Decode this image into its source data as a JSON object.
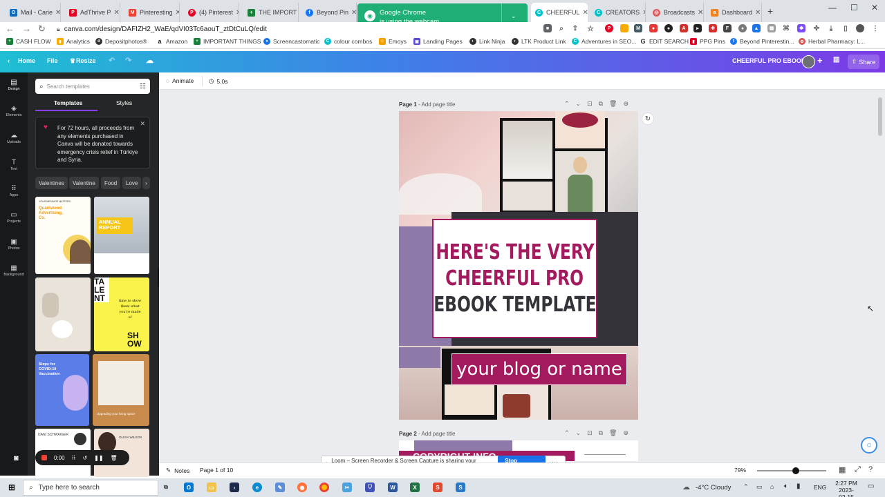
{
  "browser": {
    "tabs": [
      {
        "title": "Mail - Carie",
        "icon": "outlook-icon",
        "color": "#0f6cbd"
      },
      {
        "title": "AdThrive P",
        "icon": "pinterest-p-icon",
        "color": "#e60023"
      },
      {
        "title": "Pinteresting",
        "icon": "gmail-icon",
        "color": "#ea4335"
      },
      {
        "title": "(4) Pinterest",
        "icon": "pinterest-icon",
        "color": "#e60023"
      },
      {
        "title": "THE IMPORT",
        "icon": "sheets-icon",
        "color": "#188038"
      },
      {
        "title": "Beyond Pin",
        "icon": "facebook-icon",
        "color": "#1877f2"
      },
      {
        "title": "CHEERFUL",
        "icon": "canva-icon",
        "color": "#00c4cc"
      },
      {
        "title": "CREATORS",
        "icon": "canva-icon",
        "color": "#00c4cc"
      },
      {
        "title": "Broadcasts",
        "icon": "broadcast-icon",
        "color": "#e35b5b"
      },
      {
        "title": "Dashboard",
        "icon": "dashboard-icon",
        "color": "#f48120"
      }
    ],
    "url": "canva.com/design/DAFIZH2_WaE/qdVI03Tc6aouT_ztDtCuLQ/edit",
    "webcam_notice": {
      "line1": "Google Chrome",
      "line2": "is using the webcam"
    }
  },
  "bookmarks": [
    {
      "label": "CASH FLOW",
      "color": "#188038"
    },
    {
      "label": "Analytics",
      "color": "#f9ab00"
    },
    {
      "label": "Depositphotos®",
      "color": "#333333"
    },
    {
      "label": "Amazon",
      "color": "#222222"
    },
    {
      "label": "IMPORTANT THINGS",
      "color": "#188038"
    },
    {
      "label": "Screencastomatic",
      "color": "#1a73e8"
    },
    {
      "label": "colour combos",
      "color": "#00c4cc"
    },
    {
      "label": "Emoys",
      "color": "#f4a100"
    },
    {
      "label": "Landing Pages",
      "color": "#5b4bd6"
    },
    {
      "label": "Link Ninja",
      "color": "#333333"
    },
    {
      "label": "LTK Product Link",
      "color": "#333333"
    },
    {
      "label": "Adventures in SEO...",
      "color": "#00c4cc"
    },
    {
      "label": "EDIT SEARCH",
      "color": "#222222"
    },
    {
      "label": "PPG Pins",
      "color": "#e60023"
    },
    {
      "label": "Beyond Pinterestin...",
      "color": "#1877f2"
    },
    {
      "label": "Herbal Pharmacy: L...",
      "color": "#d9534f"
    }
  ],
  "canva_header": {
    "home": "Home",
    "file": "File",
    "resize": "Resize",
    "doc_title": "CHEERFUL PRO EBOOK",
    "share": "Share"
  },
  "rail": [
    {
      "label": "Design",
      "icon": "layout-icon"
    },
    {
      "label": "Elements",
      "icon": "shapes-icon"
    },
    {
      "label": "Uploads",
      "icon": "cloud-upload-icon"
    },
    {
      "label": "Text",
      "icon": "text-icon"
    },
    {
      "label": "Apps",
      "icon": "apps-grid-icon"
    },
    {
      "label": "Projects",
      "icon": "folder-icon"
    },
    {
      "label": "Photos",
      "icon": "photo-icon"
    },
    {
      "label": "Background",
      "icon": "background-icon"
    }
  ],
  "panel": {
    "search_placeholder": "Search templates",
    "tab_templates": "Templates",
    "tab_styles": "Styles",
    "notice": "For 72 hours, all proceeds from any elements purchased in Canva will be donated towards emergency crisis relief in Türkiye and Syria.",
    "chips": [
      "Valentines",
      "Valentine",
      "Food",
      "Love"
    ],
    "thumb1_text": {
      "top": "YOUR MESSAGE MATTERS.",
      "brand": "Quarkwood Advertising, Co."
    },
    "thumb2_text": "ANNUAL REPORT",
    "thumb4_text": {
      "left": "TA LE NT",
      "mid": "time to show them what you're made of",
      "bottom": "SH OW"
    },
    "thumb5_text": "Steps for COVID-19 Vaccination",
    "thumb6_text": "Upgrading your living space",
    "thumb7_text": "DANI SCHWAIGER",
    "thumb8_text": "OLIVIA WILSON"
  },
  "toolbar": {
    "animate": "Animate",
    "duration": "5.0s"
  },
  "pages": {
    "page1_label": "Page 1",
    "page1_hint": "- Add page title",
    "page2_label": "Page 2",
    "page2_hint": "- Add page title",
    "title_line1": "HERE'S THE VERY",
    "title_line2": "CHEERFUL PRO",
    "title_line3": "EBOOK TEMPLATE",
    "subtitle": "your blog or name",
    "page2_title": "COPYRIGHT INFO"
  },
  "bottom_bar": {
    "notes": "Notes",
    "page_count": "Page 1 of 10",
    "zoom": "79%"
  },
  "recorder": {
    "time": "0:00"
  },
  "loom": {
    "message": "Loom – Screen Recorder & Screen Capture is sharing your screen.",
    "stop": "Stop sharing",
    "hide": "Hide"
  },
  "taskbar": {
    "search_placeholder": "Type here to search",
    "weather": "-4°C  Cloudy",
    "lang": "ENG",
    "time": "2:27 PM",
    "date": "2023-02-15"
  },
  "colors": {
    "accent": "#a31b5e",
    "purple": "#8d7aa8",
    "dark": "#343339",
    "canva_link": "#8b3dff"
  }
}
